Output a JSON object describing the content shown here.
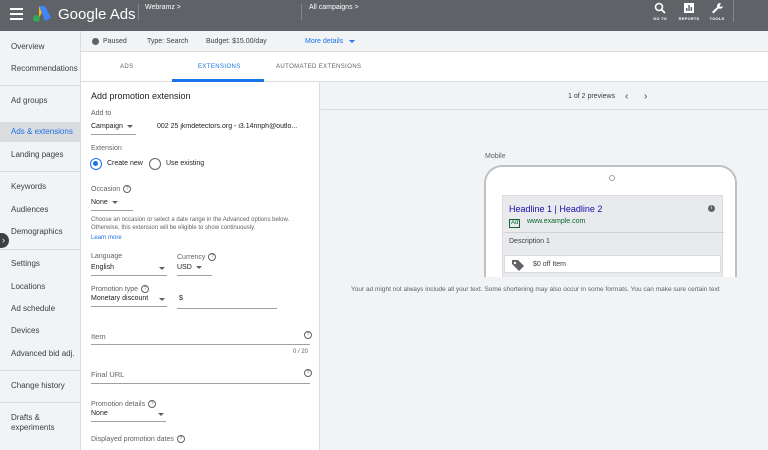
{
  "topbar": {
    "brand": "Google Ads",
    "account": "Webramz",
    "account_chevron": ">",
    "campaigns": "All campaigns",
    "campaigns_chevron": ">",
    "tools": [
      {
        "label": "GO TO",
        "icon": "search-icon"
      },
      {
        "label": "REPORTS",
        "icon": "reports-icon"
      },
      {
        "label": "TOOLS",
        "icon": "wrench-icon"
      }
    ]
  },
  "sidebar": {
    "items": [
      {
        "label": "Overview"
      },
      {
        "label": "Recommendations"
      },
      {
        "label": "Ad groups"
      },
      {
        "label": "Ads & extensions"
      },
      {
        "label": "Landing pages"
      },
      {
        "label": "Keywords"
      },
      {
        "label": "Audiences"
      },
      {
        "label": "Demographics"
      },
      {
        "label": "Settings"
      },
      {
        "label": "Locations"
      },
      {
        "label": "Ad schedule"
      },
      {
        "label": "Devices"
      },
      {
        "label": "Advanced bid adj."
      },
      {
        "label": "Change history"
      },
      {
        "label": "Drafts & experiments"
      }
    ],
    "active_index": 3,
    "collapse_glyph": "›"
  },
  "status": {
    "state": "Paused",
    "type": "Type: Search",
    "budget": "Budget: $15.00/day",
    "more": "More details"
  },
  "tabs": [
    {
      "label": "ADS"
    },
    {
      "label": "EXTENSIONS"
    },
    {
      "label": "AUTOMATED EXTENSIONS"
    }
  ],
  "form": {
    "title": "Add promotion extension",
    "add_to_label": "Add to",
    "add_to_value": "Campaign",
    "campaign_name": "002 25 jkmdetectors.org - i3.14nnph@outlo...",
    "extension_label": "Extension",
    "create_new": "Create new",
    "use_existing": "Use existing",
    "occasion_label": "Occasion",
    "occasion_value": "None",
    "occasion_help": "Choose an occasion or select a date range in the Advanced options below. Otherwise, this extension will be eligible to show continuously.",
    "learn_more": "Learn more",
    "language_label": "Language",
    "language_value": "English",
    "currency_label": "Currency",
    "currency_value": "USD",
    "promo_type_label": "Promotion type",
    "promo_type_value": "Monetary discount",
    "dollar": "$",
    "item_placeholder": "Item",
    "item_counter": "0 / 20",
    "final_url_placeholder": "Final URL",
    "promo_details_label": "Promotion details",
    "promo_details_value": "None",
    "displayed_dates_label": "Displayed promotion dates",
    "qmark": "?"
  },
  "preview": {
    "pager": "1 of 2 previews",
    "prev": "‹",
    "next": "›",
    "device_label": "Mobile",
    "ad": {
      "headline": "Headline 1 | Headline 2",
      "badge": "Ad",
      "url": "www.example.com",
      "description": "Description 1",
      "promotion": "$0 off Item",
      "info": "i"
    },
    "disclaimer": "Your ad might not always include all your text. Some shortening may also occur in some formats. You can make sure certain text"
  }
}
